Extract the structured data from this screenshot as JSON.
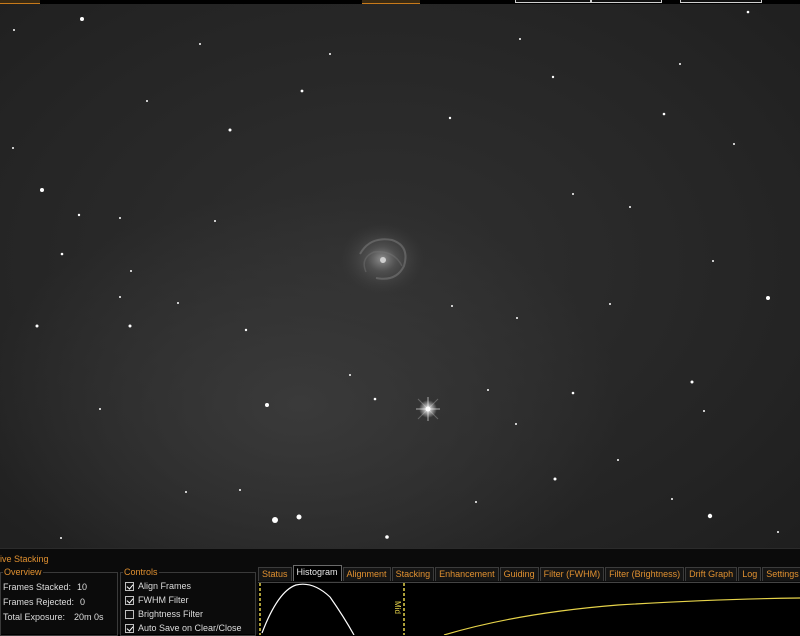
{
  "panel": {
    "title": "ive Stacking",
    "overview": {
      "title": "Overview",
      "rows": [
        {
          "label": "Frames Stacked:",
          "value": "10"
        },
        {
          "label": "Frames Rejected:",
          "value": "0"
        },
        {
          "label": "Total Exposure:",
          "value": "20m 0s"
        }
      ]
    },
    "controls": {
      "title": "Controls",
      "items": [
        {
          "label": "Align Frames",
          "checked": true
        },
        {
          "label": "FWHM Filter",
          "checked": true
        },
        {
          "label": "Brightness Filter",
          "checked": false
        },
        {
          "label": "Auto Save on Clear/Close",
          "checked": true
        }
      ]
    },
    "tabs": [
      "Status",
      "Histogram",
      "Alignment",
      "Stacking",
      "Enhancement",
      "Guiding",
      "Filter (FWHM)",
      "Filter (Brightness)",
      "Drift Graph",
      "Log",
      "Settings"
    ],
    "active_tab": "Histogram",
    "histogram": {
      "mid_label": "Mid"
    }
  },
  "colors": {
    "accent": "#e09030",
    "histogram_line": "#e6d34a",
    "background": "#0b0b0b"
  }
}
